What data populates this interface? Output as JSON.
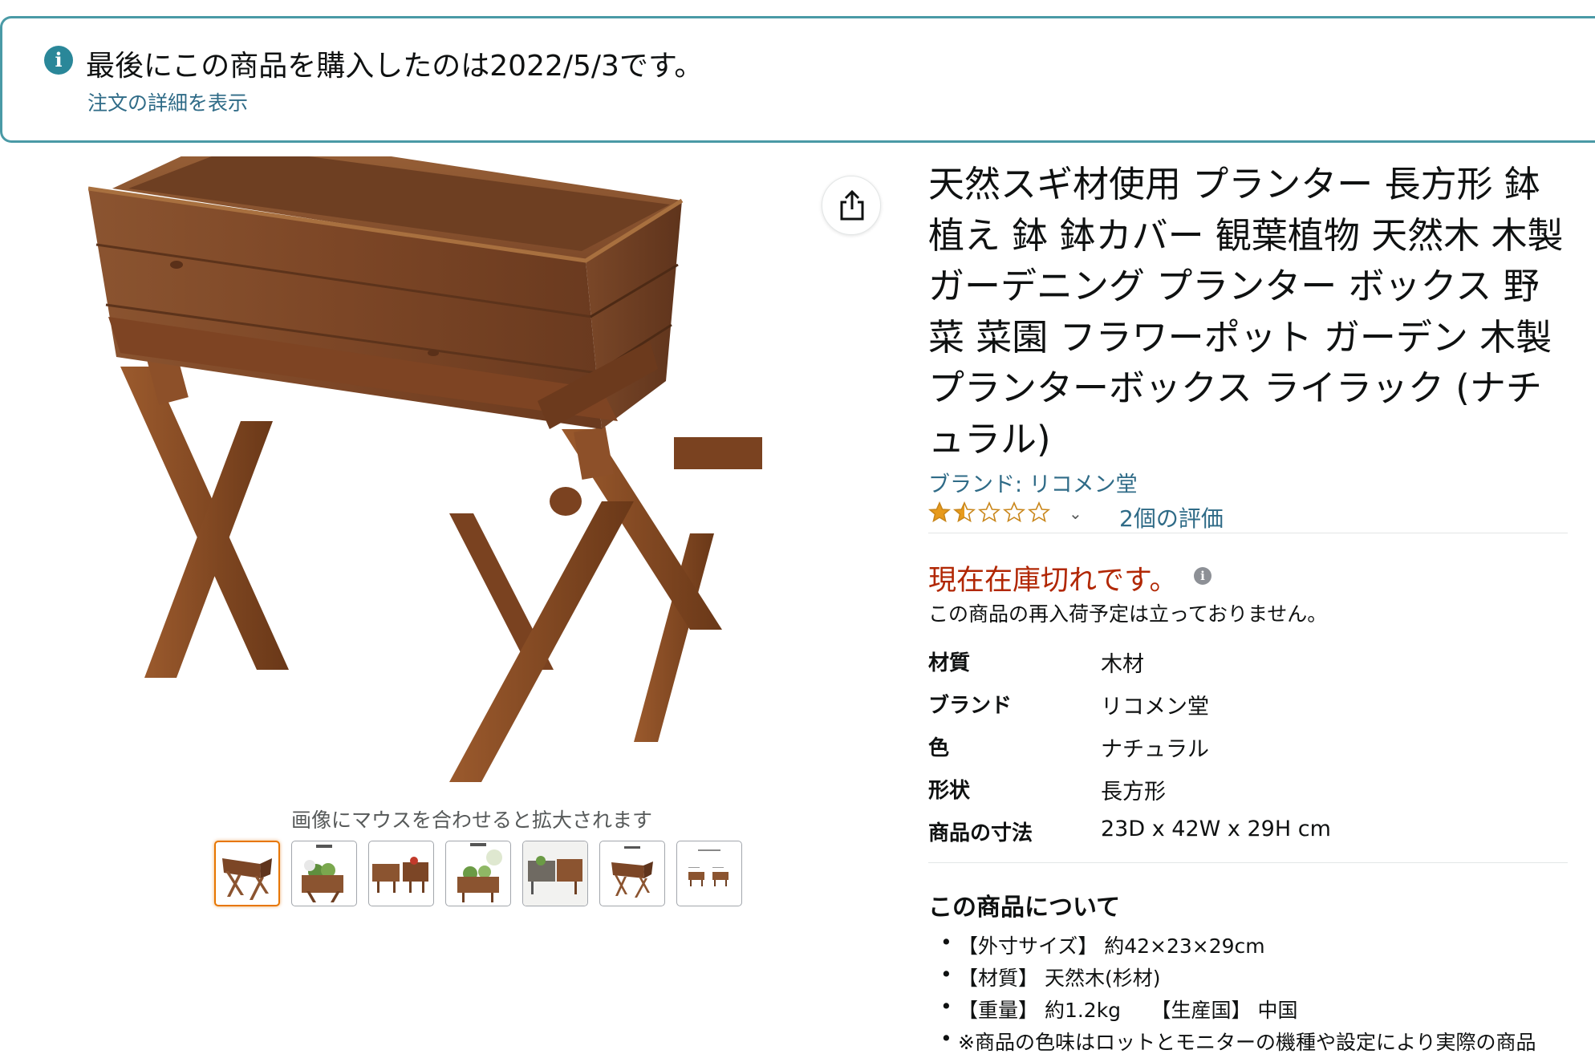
{
  "notice": {
    "icon": "info-icon",
    "message": "最後にこの商品を購入したのは2022/5/3です。",
    "link_label": "注文の詳細を表示"
  },
  "gallery": {
    "zoom_hint": "画像にマウスを合わせると拡大されます",
    "share_icon": "share-icon",
    "thumbnails": [
      "planter-front",
      "planter-with-plants",
      "planter-set",
      "planter-herbs",
      "planter-grey",
      "planter-small",
      "planter-dimensions"
    ],
    "selected_index": 0
  },
  "product": {
    "title": "天然スギ材使用 プランター 長方形 鉢植え 鉢 鉢カバー 観葉植物 天然木 木製 ガーデニング プランター ボックス 野菜 菜園 フラワーポット ガーデン 木製プランターボックス ライラック (ナチュラル)",
    "brand_link": "ブランド: リコメン堂",
    "rating_value": 1.5,
    "rating_max": 5,
    "reviews_link": "2個の評価",
    "stock_status": "現在在庫切れです。",
    "restock_note": "この商品の再入荷予定は立っておりません。"
  },
  "specs": [
    {
      "key": "材質",
      "value": "木材"
    },
    {
      "key": "ブランド",
      "value": "リコメン堂"
    },
    {
      "key": "色",
      "value": "ナチュラル"
    },
    {
      "key": "形状",
      "value": "長方形"
    },
    {
      "key": "商品の寸法",
      "value": "23D x 42W x 29H cm"
    }
  ],
  "about": {
    "title": "この商品について",
    "bullets": [
      "【外寸サイズ】 約42×23×29cm",
      "【材質】 天然木(杉材)",
      "【重量】 約1.2kg　　【生産国】 中国",
      "※商品の色味はロットとモニターの機種や設定により実際の商品"
    ]
  },
  "colors": {
    "accent_teal": "#4a9aa6",
    "link": "#2f6b87",
    "stock_red": "#b12704",
    "star": "#e79a1b",
    "thumb_selected": "#e77600",
    "wood_dark": "#6e3f22",
    "wood_mid": "#8b5430"
  }
}
